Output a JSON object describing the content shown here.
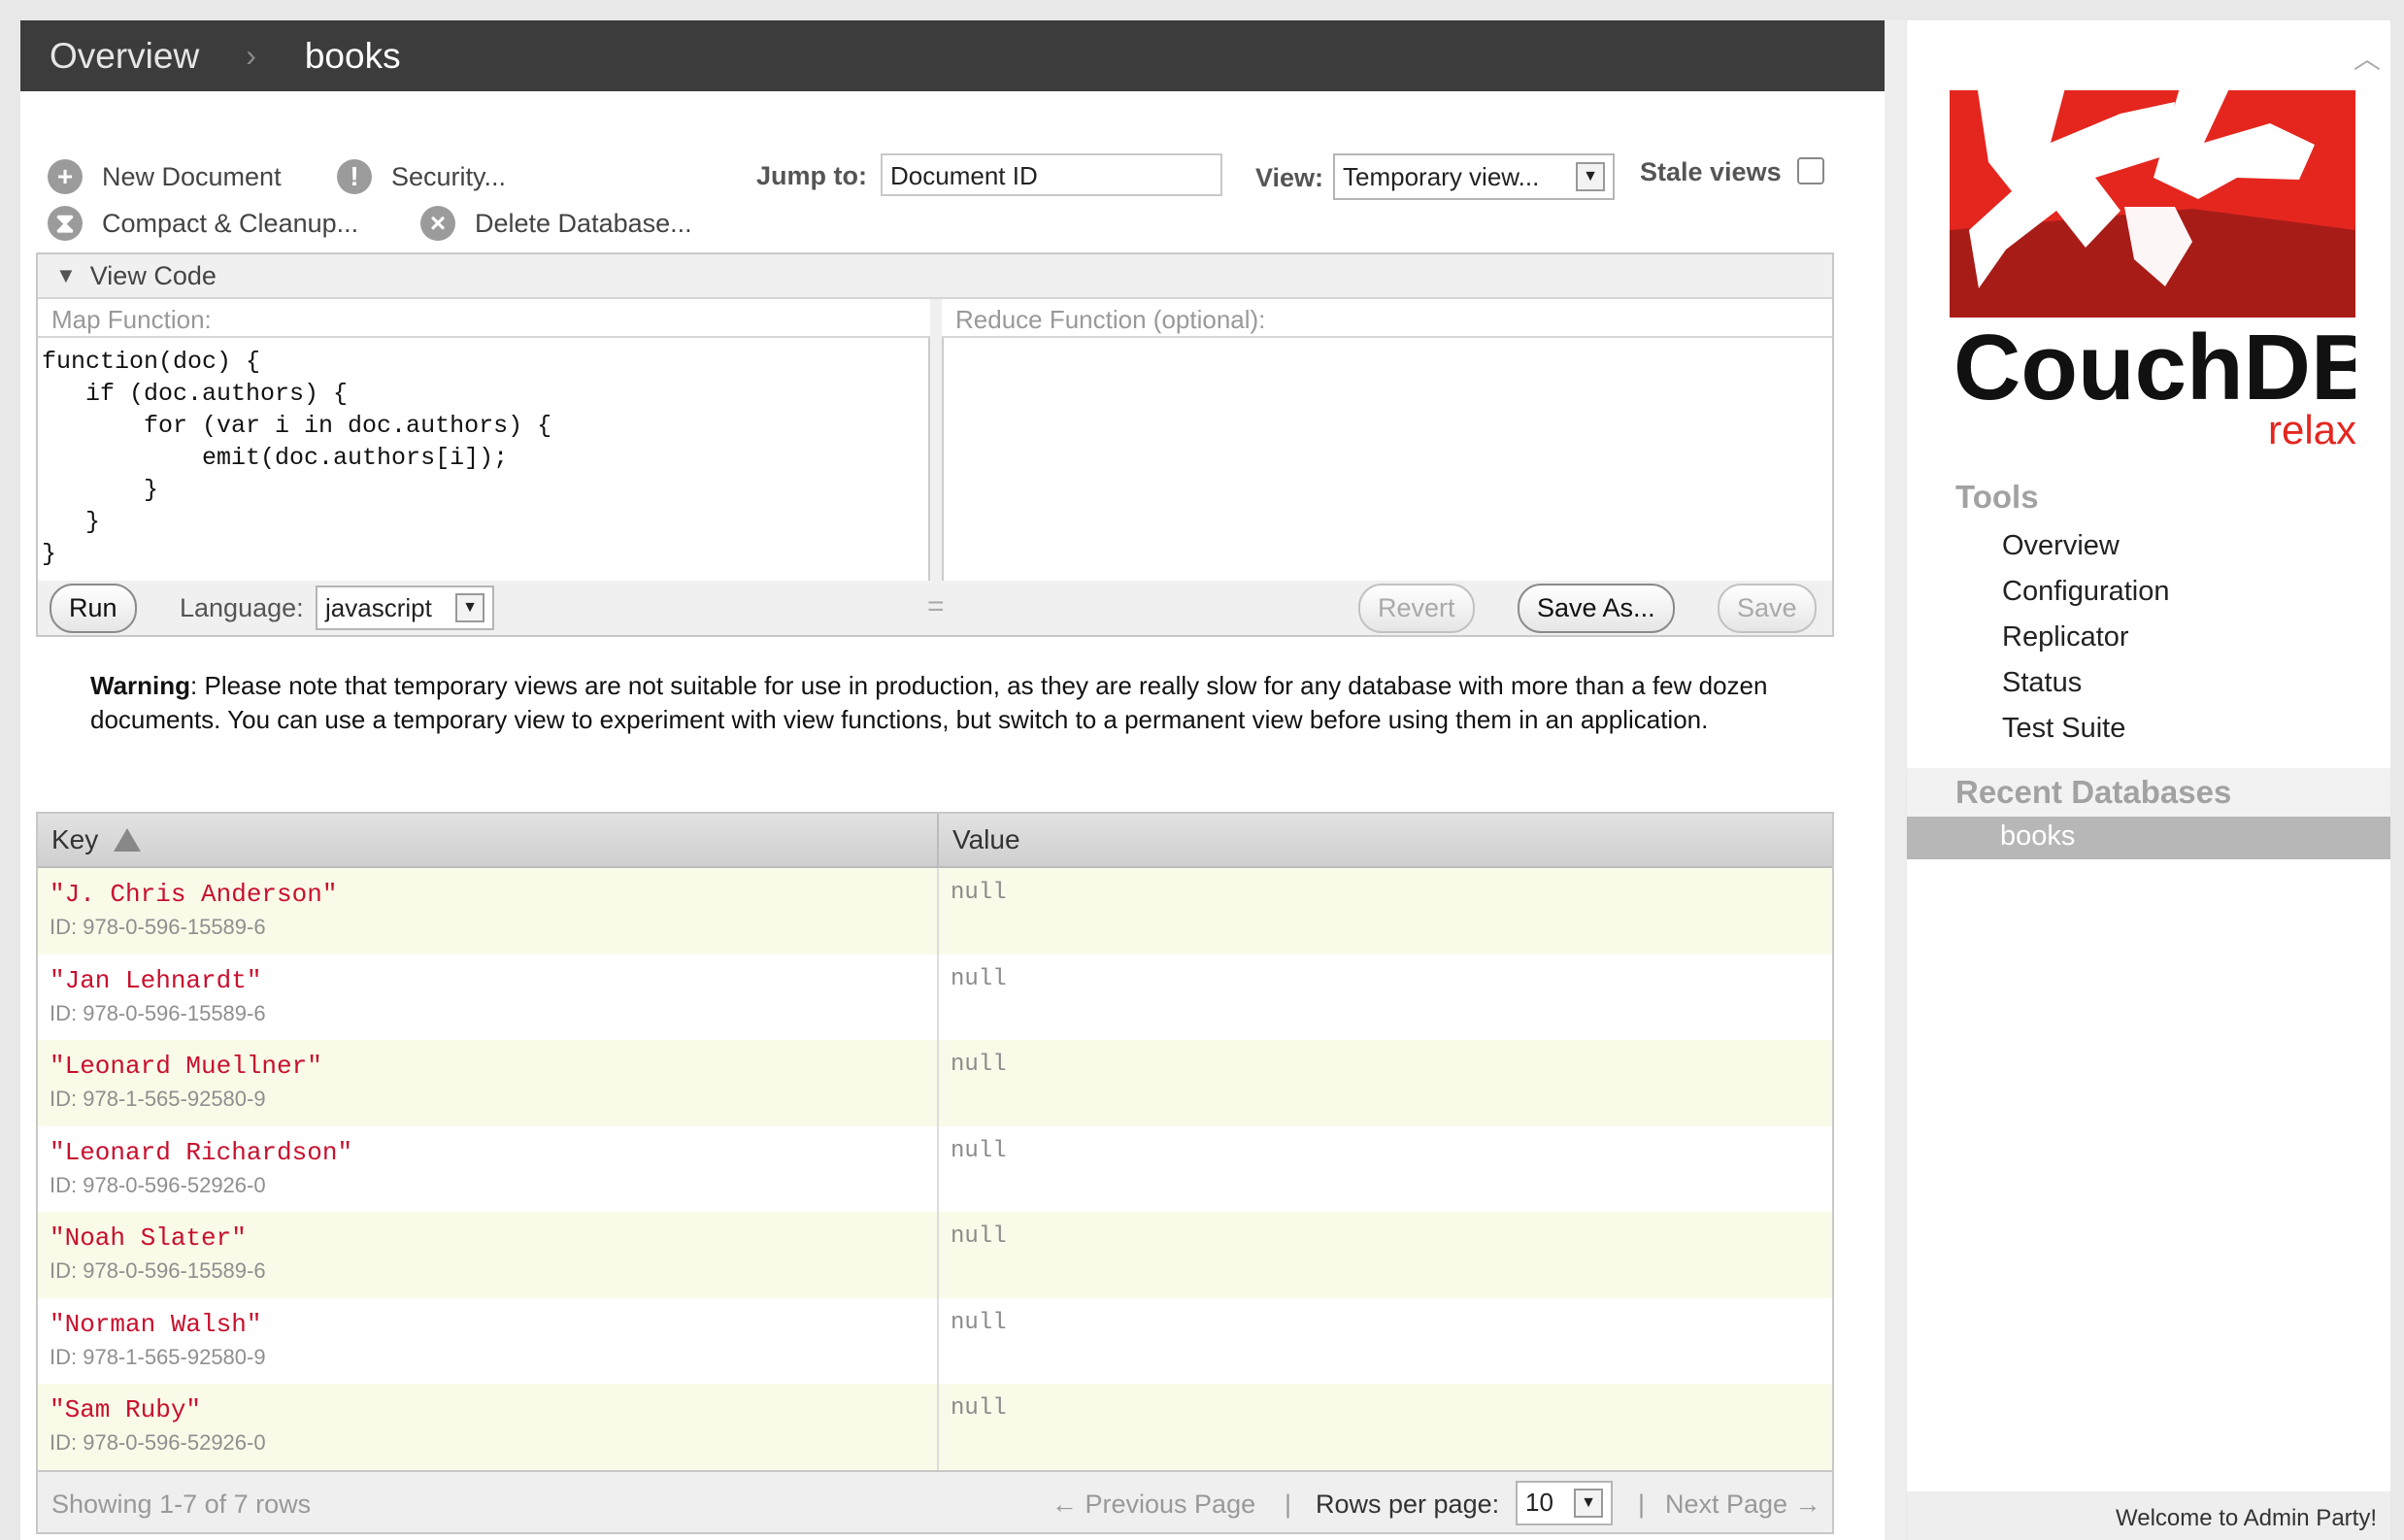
{
  "breadcrumb": {
    "root": "Overview",
    "current": "books"
  },
  "toolbar": {
    "new_document": "New Document",
    "security": "Security...",
    "compact_cleanup": "Compact & Cleanup...",
    "delete_database": "Delete Database...",
    "jump_to_label": "Jump to:",
    "jump_to_value": "Document ID",
    "view_label": "View:",
    "view_value": "Temporary view...",
    "stale_views_label": "Stale views"
  },
  "view_code": {
    "header": "View Code",
    "map_label": "Map Function:",
    "reduce_label": "Reduce Function (optional):",
    "map_code": "function(doc) {\n   if (doc.authors) {\n       for (var i in doc.authors) {\n           emit(doc.authors[i]);\n       }\n   }\n}",
    "reduce_code": "",
    "run": "Run",
    "language_label": "Language:",
    "language_value": "javascript",
    "resize_handle": "=",
    "revert": "Revert",
    "save_as": "Save As...",
    "save": "Save"
  },
  "warning": {
    "bold": "Warning",
    "text": ": Please note that temporary views are not suitable for use in production, as they are really slow for any database with more than a few dozen documents. You can use a temporary view to experiment with view functions, but switch to a permanent view before using them in an application."
  },
  "results": {
    "headers": {
      "key": "Key",
      "value": "Value"
    },
    "rows": [
      {
        "key": "\"J. Chris Anderson\"",
        "id": "ID: 978-0-596-15589-6",
        "value": "null"
      },
      {
        "key": "\"Jan Lehnardt\"",
        "id": "ID: 978-0-596-15589-6",
        "value": "null"
      },
      {
        "key": "\"Leonard Muellner\"",
        "id": "ID: 978-1-565-92580-9",
        "value": "null"
      },
      {
        "key": "\"Leonard Richardson\"",
        "id": "ID: 978-0-596-52926-0",
        "value": "null"
      },
      {
        "key": "\"Noah Slater\"",
        "id": "ID: 978-0-596-15589-6",
        "value": "null"
      },
      {
        "key": "\"Norman Walsh\"",
        "id": "ID: 978-1-565-92580-9",
        "value": "null"
      },
      {
        "key": "\"Sam Ruby\"",
        "id": "ID: 978-0-596-52926-0",
        "value": "null"
      }
    ],
    "footer": {
      "showing": "Showing 1-7 of 7 rows",
      "prev": "← Previous Page",
      "divider": "|",
      "rows_per_page_label": "Rows per page:",
      "rows_per_page_value": "10",
      "next": "Next Page →"
    }
  },
  "sidebar": {
    "logo_text": "CouchDB",
    "logo_tagline": "relax",
    "tools_title": "Tools",
    "tools": [
      "Overview",
      "Configuration",
      "Replicator",
      "Status",
      "Test Suite"
    ],
    "recent_title": "Recent Databases",
    "recent": [
      "books"
    ],
    "welcome": "Welcome to Admin Party!"
  },
  "colors": {
    "topbar": "#3c3c3c",
    "key_text": "#c8102e",
    "logo_red": "#e4261f",
    "odd_row": "#fafae8"
  }
}
